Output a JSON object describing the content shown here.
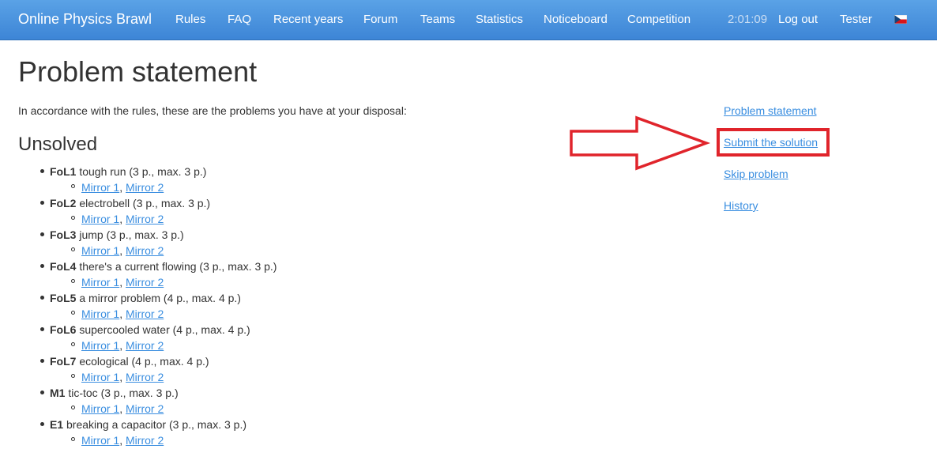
{
  "navbar": {
    "brand": "Online Physics Brawl",
    "links": [
      "Rules",
      "FAQ",
      "Recent years",
      "Forum",
      "Teams",
      "Statistics",
      "Noticeboard",
      "Competition"
    ],
    "clock": "2:01:09",
    "logout": "Log out",
    "user": "Tester",
    "flag": "cz-flag-icon"
  },
  "page": {
    "title": "Problem statement",
    "intro": "In accordance with the rules, these are the problems you have at your disposal:",
    "section_title": "Unsolved"
  },
  "problems": [
    {
      "code": "FoL1",
      "desc": " tough run (3 p., max. 3 p.)",
      "mirror1": "Mirror 1",
      "mirror2": "Mirror 2"
    },
    {
      "code": "FoL2",
      "desc": " electrobell (3 p., max. 3 p.)",
      "mirror1": "Mirror 1",
      "mirror2": "Mirror 2"
    },
    {
      "code": "FoL3",
      "desc": " jump (3 p., max. 3 p.)",
      "mirror1": "Mirror 1",
      "mirror2": "Mirror 2"
    },
    {
      "code": "FoL4",
      "desc": " there's a current flowing (3 p., max. 3 p.)",
      "mirror1": "Mirror 1",
      "mirror2": "Mirror 2"
    },
    {
      "code": "FoL5",
      "desc": " a mirror problem (4 p., max. 4 p.)",
      "mirror1": "Mirror 1",
      "mirror2": "Mirror 2"
    },
    {
      "code": "FoL6",
      "desc": " supercooled water (4 p., max. 4 p.)",
      "mirror1": "Mirror 1",
      "mirror2": "Mirror 2"
    },
    {
      "code": "FoL7",
      "desc": " ecological (4 p., max. 4 p.)",
      "mirror1": "Mirror 1",
      "mirror2": "Mirror 2"
    },
    {
      "code": "M1",
      "desc": " tic-toc (3 p., max. 3 p.)",
      "mirror1": "Mirror 1",
      "mirror2": "Mirror 2"
    },
    {
      "code": "E1",
      "desc": " breaking a capacitor (3 p., max. 3 p.)",
      "mirror1": "Mirror 1",
      "mirror2": "Mirror 2"
    }
  ],
  "sidebar": {
    "links": [
      "Problem statement",
      "Submit the solution",
      "Skip problem",
      "History"
    ]
  },
  "colors": {
    "navbar": "#4a93e0",
    "link": "#3a8ee0",
    "highlight": "#e0242b"
  }
}
